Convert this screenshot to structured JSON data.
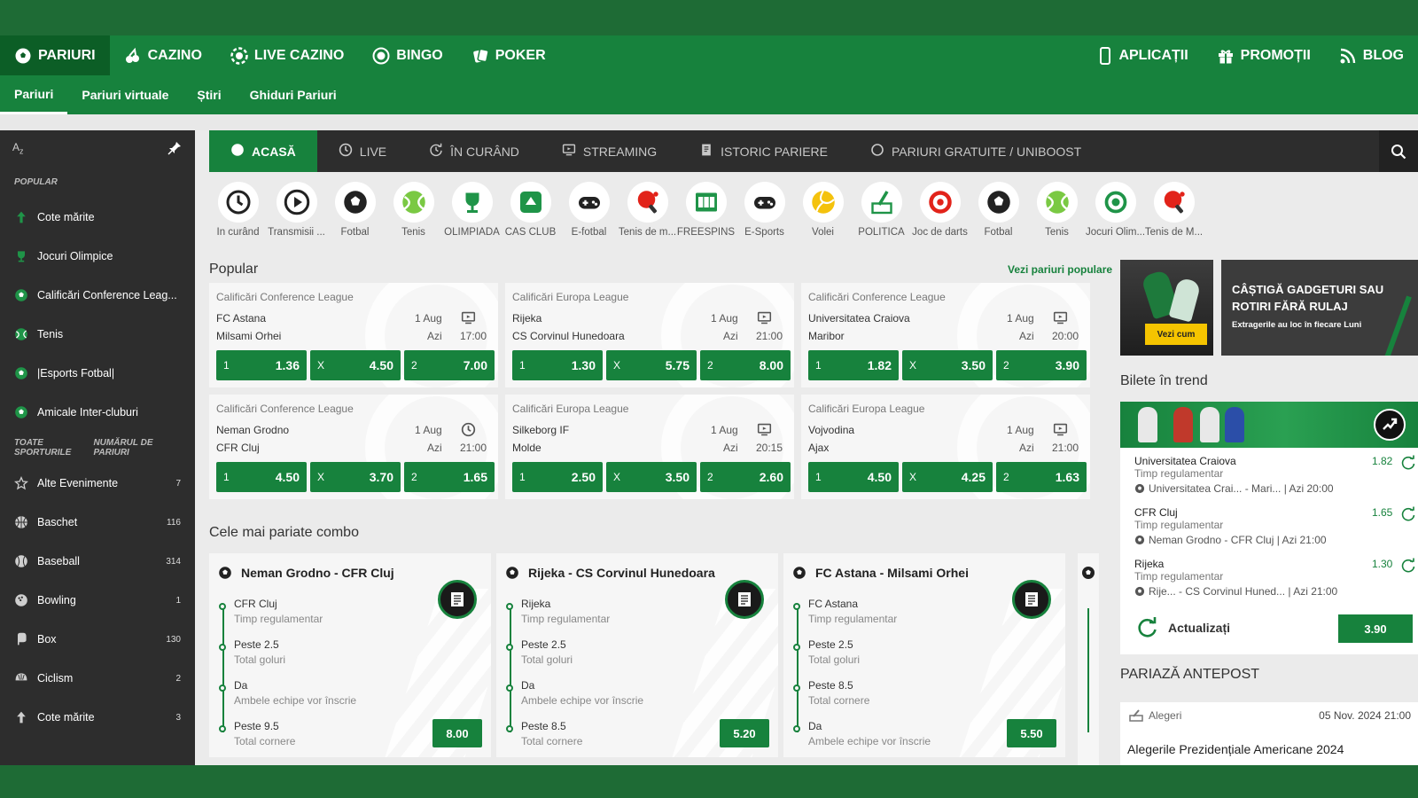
{
  "colors": {
    "brand_green": "#17823d",
    "dark_green": "#1e6b35",
    "dark_gray": "#2d2d2d",
    "yellow": "#f5c400"
  },
  "main_nav": {
    "left": [
      {
        "label": "PARIURI",
        "icon": "soccer-ball-icon"
      },
      {
        "label": "CAZINO",
        "icon": "cherries-icon"
      },
      {
        "label": "LIVE CAZINO",
        "icon": "chip-icon"
      },
      {
        "label": "BINGO",
        "icon": "bingo-ball-icon"
      },
      {
        "label": "POKER",
        "icon": "cards-icon"
      }
    ],
    "right": [
      {
        "label": "APLICAȚII",
        "icon": "phone-icon"
      },
      {
        "label": "PROMOȚII",
        "icon": "gift-icon"
      },
      {
        "label": "BLOG",
        "icon": "rss-icon"
      }
    ]
  },
  "sub_nav": [
    "Pariuri",
    "Pariuri virtuale",
    "Știri",
    "Ghiduri Pariuri"
  ],
  "sidebar": {
    "az": "AZ",
    "popular_title": "POPULAR",
    "popular": [
      {
        "label": "Cote mărite",
        "icon": "arrow-up-icon"
      },
      {
        "label": "Jocuri Olimpice",
        "icon": "trophy-icon"
      },
      {
        "label": "Calificări Conference Leag...",
        "icon": "soccer-ball-icon"
      },
      {
        "label": "Tenis",
        "icon": "tennis-ball-icon"
      },
      {
        "label": "|Esports Fotbal|",
        "icon": "soccer-ball-icon"
      },
      {
        "label": "Amicale Inter-cluburi",
        "icon": "soccer-ball-icon"
      }
    ],
    "all_title": "TOATE SPORTURILE",
    "all_count_title": "NUMĂRUL DE PARIURI",
    "all": [
      {
        "label": "Alte Evenimente",
        "count": "7",
        "icon": "star-icon"
      },
      {
        "label": "Baschet",
        "count": "116",
        "icon": "basketball-icon"
      },
      {
        "label": "Baseball",
        "count": "314",
        "icon": "baseball-icon"
      },
      {
        "label": "Bowling",
        "count": "1",
        "icon": "bowling-icon"
      },
      {
        "label": "Box",
        "count": "130",
        "icon": "boxing-glove-icon"
      },
      {
        "label": "Ciclism",
        "count": "2",
        "icon": "helmet-icon"
      },
      {
        "label": "Cote mărite",
        "count": "3",
        "icon": "arrow-up-icon"
      }
    ]
  },
  "tabs": [
    {
      "label": "ACASĂ",
      "icon": "soccer-ball-icon"
    },
    {
      "label": "LIVE",
      "icon": "clock-icon"
    },
    {
      "label": "ÎN CURÂND",
      "icon": "refresh-clock-icon"
    },
    {
      "label": "STREAMING",
      "icon": "monitor-icon"
    },
    {
      "label": "ISTORIC PARIERE",
      "icon": "receipt-icon"
    },
    {
      "label": "PARIURI GRATUITE / UNIBOOST",
      "icon": "circle-icon"
    }
  ],
  "sports": [
    {
      "label": "În curând",
      "icon": "clock-icon"
    },
    {
      "label": "Transmisii ...",
      "icon": "play-icon"
    },
    {
      "label": "Fotbal",
      "icon": "soccer-ball-icon"
    },
    {
      "label": "Tenis",
      "icon": "tennis-ball-icon"
    },
    {
      "label": "OLIMPIADA",
      "icon": "trophy-icon"
    },
    {
      "label": "CAS CLUB",
      "icon": "cas-club-icon"
    },
    {
      "label": "E-fotbal",
      "icon": "gamepad-icon"
    },
    {
      "label": "Tenis de m...",
      "icon": "ping-pong-icon"
    },
    {
      "label": "FREESPINS",
      "icon": "slot-icon"
    },
    {
      "label": "E-Sports",
      "icon": "gamepad-icon"
    },
    {
      "label": "Volei",
      "icon": "volleyball-icon"
    },
    {
      "label": "POLITICA",
      "icon": "ballot-icon"
    },
    {
      "label": "Joc de darts",
      "icon": "dartboard-icon"
    },
    {
      "label": "Fotbal",
      "icon": "soccer-ball-icon"
    },
    {
      "label": "Tenis",
      "icon": "tennis-ball-icon"
    },
    {
      "label": "Jocuri Olim...",
      "icon": "olympic-icon"
    },
    {
      "label": "Tenis de M...",
      "icon": "ping-pong-icon"
    }
  ],
  "popular": {
    "title": "Popular",
    "see_all": "Vezi pariuri populare",
    "matches": [
      {
        "league": "Calificări Conference League",
        "home": "FC Astana",
        "away": "Milsami Orhei",
        "date": "1 Aug",
        "day": "Azi",
        "time": "17:00",
        "icon": "monitor-icon",
        "odds": [
          "1.36",
          "4.50",
          "7.00"
        ]
      },
      {
        "league": "Calificări Europa League",
        "home": "Rijeka",
        "away": "CS Corvinul Hunedoara",
        "date": "1 Aug",
        "day": "Azi",
        "time": "21:00",
        "icon": "monitor-icon",
        "odds": [
          "1.30",
          "5.75",
          "8.00"
        ]
      },
      {
        "league": "Calificări Conference League",
        "home": "Universitatea Craiova",
        "away": "Maribor",
        "date": "1 Aug",
        "day": "Azi",
        "time": "20:00",
        "icon": "monitor-icon",
        "odds": [
          "1.82",
          "3.50",
          "3.90"
        ]
      },
      {
        "league": "Calificări Conference League",
        "home": "Neman Grodno",
        "away": "CFR Cluj",
        "date": "1 Aug",
        "day": "Azi",
        "time": "21:00",
        "icon": "clock-icon",
        "odds": [
          "4.50",
          "3.70",
          "1.65"
        ]
      },
      {
        "league": "Calificări Europa League",
        "home": "Silkeborg IF",
        "away": "Molde",
        "date": "1 Aug",
        "day": "Azi",
        "time": "20:15",
        "icon": "monitor-icon",
        "odds": [
          "2.50",
          "3.50",
          "2.60"
        ]
      },
      {
        "league": "Calificări Europa League",
        "home": "Vojvodina",
        "away": "Ajax",
        "date": "1 Aug",
        "day": "Azi",
        "time": "21:00",
        "icon": "monitor-icon",
        "odds": [
          "4.50",
          "4.25",
          "1.63"
        ]
      }
    ],
    "outcomes": [
      "1",
      "X",
      "2"
    ]
  },
  "combo": {
    "title": "Cele mai pariate combo",
    "cards": [
      {
        "title": "Neman Grodno - CFR Cluj",
        "total": "8.00",
        "legs": [
          {
            "a": "CFR Cluj",
            "b": "Timp regulamentar"
          },
          {
            "a": "Peste 2.5",
            "b": "Total goluri"
          },
          {
            "a": "Da",
            "b": "Ambele echipe vor înscrie"
          },
          {
            "a": "Peste 9.5",
            "b": "Total cornere"
          }
        ]
      },
      {
        "title": "Rijeka - CS Corvinul Hunedoara",
        "total": "5.20",
        "legs": [
          {
            "a": "Rijeka",
            "b": "Timp regulamentar"
          },
          {
            "a": "Peste 2.5",
            "b": "Total goluri"
          },
          {
            "a": "Da",
            "b": "Ambele echipe vor înscrie"
          },
          {
            "a": "Peste 8.5",
            "b": "Total cornere"
          }
        ]
      },
      {
        "title": "FC Astana - Milsami Orhei",
        "total": "5.50",
        "legs": [
          {
            "a": "FC Astana",
            "b": "Timp regulamentar"
          },
          {
            "a": "Peste 2.5",
            "b": "Total goluri"
          },
          {
            "a": "Peste 8.5",
            "b": "Total cornere"
          },
          {
            "a": "Da",
            "b": "Ambele echipe vor înscrie"
          }
        ]
      }
    ]
  },
  "promo": {
    "button": "Vezi cum",
    "headline": "CÂȘTIGĂ GADGETURI SAU ROTIRI FĂRĂ RULAJ",
    "sub": "Extragerile au loc în fiecare Luni"
  },
  "trending": {
    "title": "Bilete în trend",
    "legs": [
      {
        "name": "Universitatea Craiova",
        "market": "Timp regulamentar",
        "event": "Universitatea Crai... - Mari...",
        "when": "| Azi 20:00",
        "odd": "1.82"
      },
      {
        "name": "CFR Cluj",
        "market": "Timp regulamentar",
        "event": "Neman Grodno - CFR Cluj",
        "when": "| Azi 21:00",
        "odd": "1.65"
      },
      {
        "name": "Rijeka",
        "market": "Timp regulamentar",
        "event": "Rije... - CS Corvinul Huned...",
        "when": "| Azi 21:00",
        "odd": "1.30"
      }
    ],
    "refresh": "Actualizați",
    "total": "3.90"
  },
  "antepost": {
    "title": "PARIAZĂ ANTEPOST",
    "category": "Alegeri",
    "date": "05 Nov. 2024 21:00",
    "event": "Alegerile Prezidențiale Americane 2024"
  }
}
